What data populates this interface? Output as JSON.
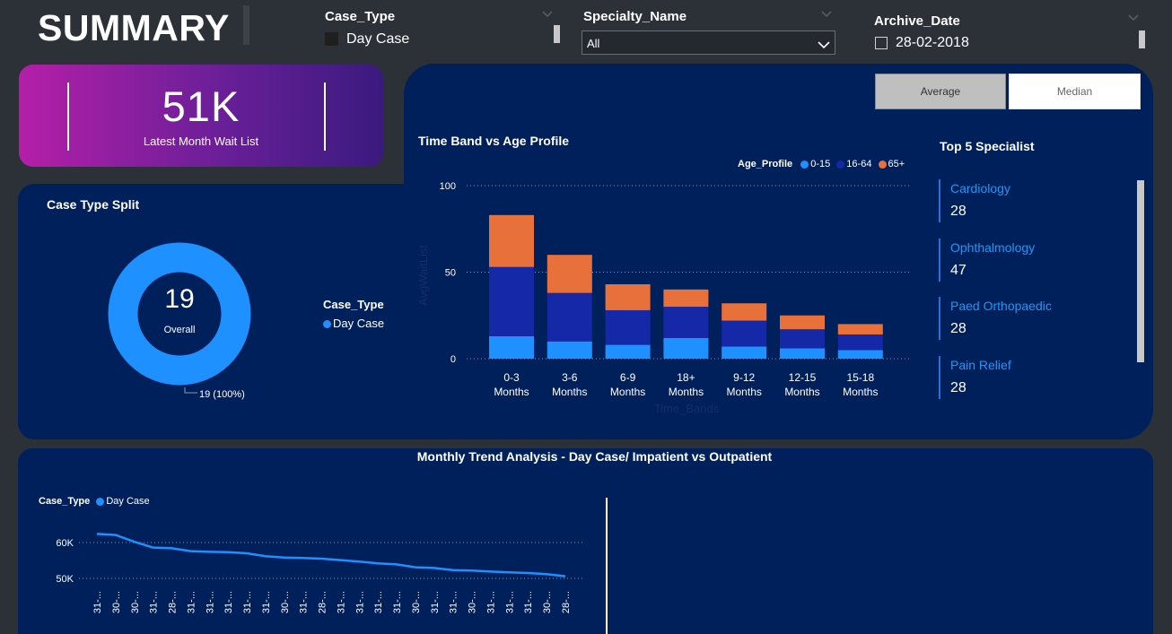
{
  "header": {
    "title": "SUMMARY"
  },
  "slicers": {
    "case_type": {
      "label": "Case_Type",
      "option": "Day Case"
    },
    "specialty": {
      "label": "Specialty_Name",
      "selected": "All"
    },
    "archive_date": {
      "label": "Archive_Date",
      "option": "28-02-2018"
    }
  },
  "kpi": {
    "value": "51K",
    "label": "Latest Month Wait List"
  },
  "toggle": {
    "average_label": "Average",
    "median_label": "Median"
  },
  "case_type_split": {
    "title": "Case Type Split",
    "center_value": "19",
    "center_label": "Overall",
    "slice_label": "19 (100%)",
    "legend_title": "Case_Type",
    "legend_item": "Day Case",
    "color": "#1e90ff"
  },
  "specialists": {
    "title": "Top 5 Specialist",
    "items": [
      {
        "name": "Cardiology",
        "value": "28"
      },
      {
        "name": "Ophthalmology",
        "value": "47"
      },
      {
        "name": "Paed Orthopaedic",
        "value": "28"
      },
      {
        "name": "Pain Relief",
        "value": "28"
      }
    ]
  },
  "colors": {
    "age_0_15": "#1e90ff",
    "age_16_64": "#1529a8",
    "age_65": "#e8703a",
    "trend": "#1e90ff"
  },
  "chart_data": [
    {
      "type": "bar",
      "stacked": true,
      "title": "Time Band vs Age Profile",
      "legend_title": "Age_Profile",
      "xlabel": "Time_Bands",
      "ylabel": "AvgWaitList",
      "ylim": [
        0,
        100
      ],
      "yticks": [
        "0",
        "50",
        "100"
      ],
      "categories": [
        [
          "0-3",
          "Months"
        ],
        [
          "3-6",
          "Months"
        ],
        [
          "6-9",
          "Months"
        ],
        [
          "18+",
          "Months"
        ],
        [
          "9-12",
          "Months"
        ],
        [
          "12-15",
          "Months"
        ],
        [
          "15-18",
          "Months"
        ]
      ],
      "series": [
        {
          "name": "0-15",
          "values": [
            13,
            10,
            8,
            12,
            7,
            6,
            5
          ]
        },
        {
          "name": "16-64",
          "values": [
            40,
            28,
            20,
            18,
            15,
            11,
            9
          ]
        },
        {
          "name": "65+",
          "values": [
            30,
            22,
            15,
            10,
            10,
            8,
            6
          ]
        }
      ]
    },
    {
      "type": "line",
      "title": "Monthly Trend Analysis - Day Case/ Impatient vs Outpatient",
      "legend_title": "Case_Type",
      "legend_item": "Day Case",
      "yticks": [
        "50K",
        "60K"
      ],
      "ylim": [
        45000,
        65000
      ],
      "x": [
        "31-...",
        "30-...",
        "30-...",
        "31-...",
        "28-...",
        "31-...",
        "31-...",
        "31-...",
        "31-...",
        "31-...",
        "30-...",
        "31-...",
        "28-...",
        "31-...",
        "31-...",
        "31-...",
        "31-...",
        "30-...",
        "31-...",
        "31-...",
        "30-...",
        "31-...",
        "31-...",
        "31-...",
        "30-...",
        "28-..."
      ],
      "values": [
        62400,
        62100,
        60200,
        58600,
        58400,
        57600,
        57400,
        57300,
        57000,
        56200,
        55800,
        55700,
        55500,
        55100,
        54700,
        54200,
        53900,
        53100,
        52900,
        52300,
        52200,
        51900,
        51700,
        51500,
        51200,
        50600
      ]
    }
  ]
}
